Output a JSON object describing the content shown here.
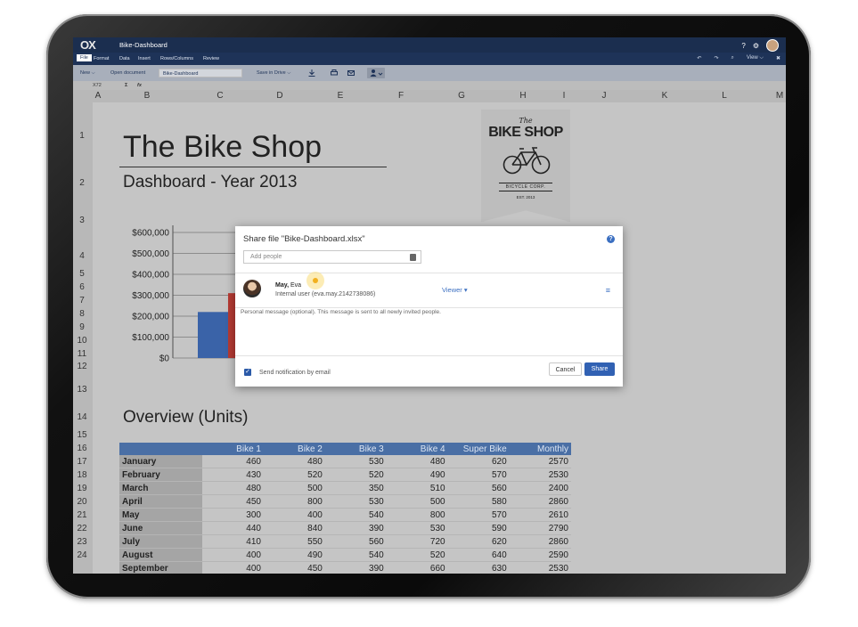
{
  "app": {
    "logo": "OX",
    "title": "Bike-Dashboard"
  },
  "topbar": {
    "help": "?",
    "settings": "⚙"
  },
  "menu": {
    "items": [
      "File",
      "Format",
      "Data",
      "Insert",
      "Rows/Columns",
      "Review"
    ],
    "right": [
      "↶",
      "↷",
      "⌕",
      "View ⌵",
      "✖"
    ]
  },
  "toolbar": {
    "new": "New ⌵",
    "open": "Open document",
    "filename": "Bike-Dashboard",
    "save": "Save in Drive ⌵"
  },
  "formula": {
    "cell": "X72",
    "sigma": "Σ",
    "fx": "fx"
  },
  "columns": [
    "A",
    "B",
    "C",
    "D",
    "E",
    "F",
    "G",
    "H",
    "I",
    "J",
    "K",
    "L",
    "M"
  ],
  "rows": [
    "1",
    "2",
    "3",
    "4",
    "5",
    "6",
    "7",
    "8",
    "9",
    "10",
    "11",
    "12",
    "13",
    "14",
    "15",
    "16",
    "17",
    "18",
    "19",
    "20",
    "21",
    "22",
    "23",
    "24"
  ],
  "sheet": {
    "title": "The Bike Shop",
    "subtitle": "Dashboard - Year 2013",
    "logo": {
      "the": "The",
      "main": "BIKE SHOP",
      "corp": "BICYCLE CORP.",
      "est": "EST. 2013"
    },
    "overview_title": "Overview (Units)"
  },
  "chart_data": {
    "type": "bar",
    "title": "",
    "yticks": [
      "$600,000",
      "$500,000",
      "$400,000",
      "$300,000",
      "$200,000",
      "$100,000",
      "$0"
    ],
    "ylim": [
      0,
      600000
    ],
    "series": [
      {
        "values": [
          220000
        ],
        "color": "#3a63a8"
      },
      {
        "values": [
          310000
        ],
        "color": "#b53a33"
      }
    ]
  },
  "table": {
    "headers": [
      "",
      "Bike 1",
      "Bike 2",
      "Bike 3",
      "Bike 4",
      "Super Bike",
      "Monthly"
    ],
    "rows": [
      [
        "January",
        "460",
        "480",
        "530",
        "480",
        "620",
        "2570"
      ],
      [
        "February",
        "430",
        "520",
        "520",
        "490",
        "570",
        "2530"
      ],
      [
        "March",
        "480",
        "500",
        "350",
        "510",
        "560",
        "2400"
      ],
      [
        "April",
        "450",
        "800",
        "530",
        "500",
        "580",
        "2860"
      ],
      [
        "May",
        "300",
        "400",
        "540",
        "800",
        "570",
        "2610"
      ],
      [
        "June",
        "440",
        "840",
        "390",
        "530",
        "590",
        "2790"
      ],
      [
        "July",
        "410",
        "550",
        "560",
        "720",
        "620",
        "2860"
      ],
      [
        "August",
        "400",
        "490",
        "540",
        "520",
        "640",
        "2590"
      ],
      [
        "September",
        "400",
        "450",
        "390",
        "660",
        "630",
        "2530"
      ]
    ]
  },
  "dialog": {
    "title": "Share file \"Bike-Dashboard.xlsx\"",
    "add_placeholder": "Add people",
    "user_last": "May,",
    "user_first": "Eva",
    "user_sub": "Internal user (eva.may.2142738086)",
    "role": "Viewer ▾",
    "message_placeholder": "Personal message (optional). This message is sent to all newly invited people.",
    "notify_label": "Send notification by email",
    "cancel": "Cancel",
    "share": "Share"
  }
}
